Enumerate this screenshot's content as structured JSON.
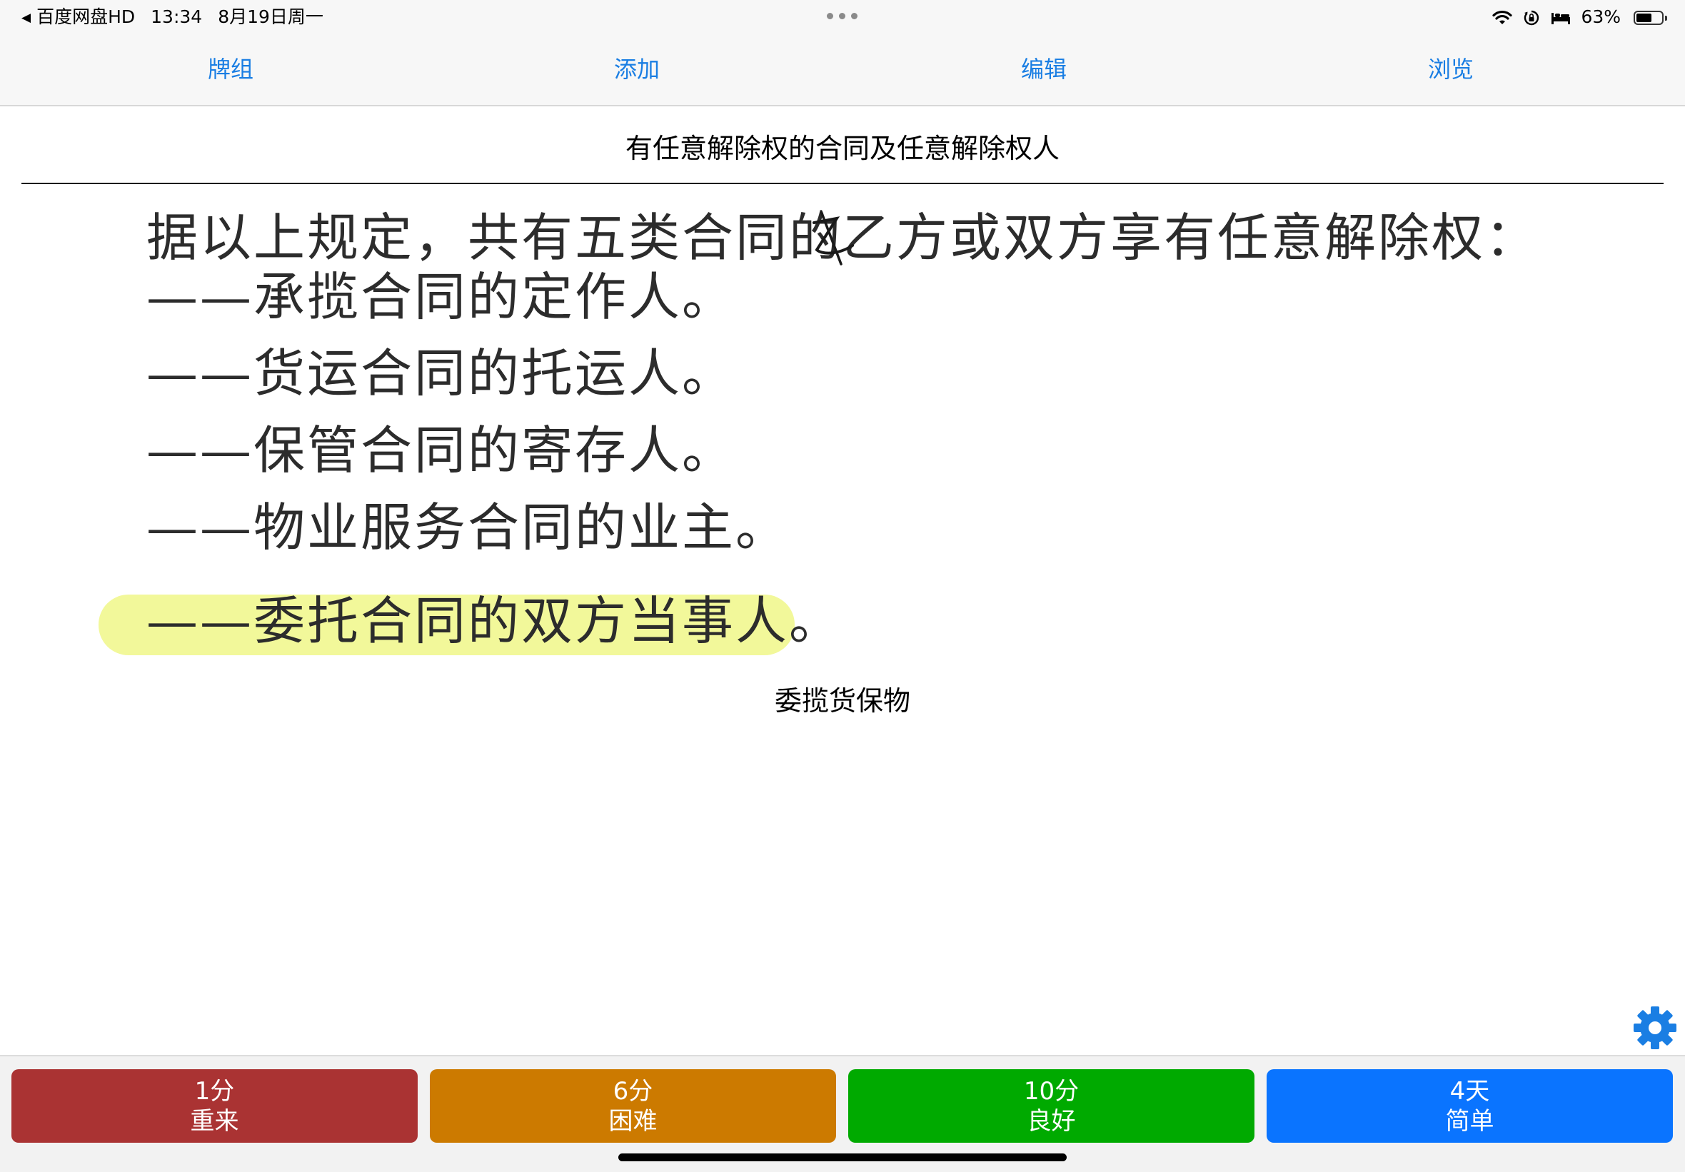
{
  "status_bar": {
    "back_app": "百度网盘HD",
    "time": "13:34",
    "date": "8月19日周一",
    "battery_percent": "63%",
    "battery_level": 0.63
  },
  "top_tabs": [
    {
      "label": "牌组"
    },
    {
      "label": "添加"
    },
    {
      "label": "编辑"
    },
    {
      "label": "浏览"
    }
  ],
  "card": {
    "question": "有任意解除权的合同及任意解除权人",
    "scan_lines": [
      "据以上规定，共有五类合同的乙方或双方享有任意解除权：",
      "——承揽合同的定作人。",
      "——货运合同的托运人。",
      "——保管合同的寄存人。",
      "——物业服务合同的业主。",
      "——委托合同的双方当事人。"
    ],
    "answer": "委揽货保物"
  },
  "icons": {
    "settings": "gear-icon",
    "back": "back-arrow-icon",
    "wifi": "wifi-icon",
    "orientation_lock": "orientation-lock-icon",
    "sleep": "bed-icon",
    "battery": "battery-icon"
  },
  "answer_buttons": [
    {
      "interval": "1分",
      "ease": "重来",
      "color": "#aa3333"
    },
    {
      "interval": "6分",
      "ease": "困难",
      "color": "#cc7a00"
    },
    {
      "interval": "10分",
      "ease": "良好",
      "color": "#00aa00"
    },
    {
      "interval": "4天",
      "ease": "简单",
      "color": "#0a74ff"
    }
  ],
  "colors": {
    "tab_text": "#1a7ee3",
    "gear": "#1a7ee3",
    "highlight": "#eef578"
  }
}
